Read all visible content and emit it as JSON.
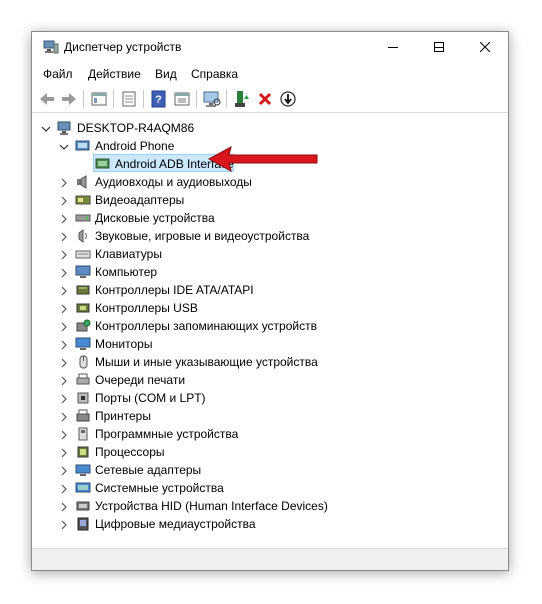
{
  "window": {
    "title": "Диспетчер устройств",
    "buttons": [
      "minimize",
      "maximize",
      "close"
    ]
  },
  "menu": {
    "file": "Файл",
    "action": "Действие",
    "view": "Вид",
    "help": "Справка"
  },
  "toolbar": {
    "icons": [
      "back-icon",
      "forward-icon",
      "properties-icon",
      "update-view-icon",
      "help-icon",
      "show-hidden-icon",
      "scan-hardware-icon",
      "update-driver-icon",
      "uninstall-icon",
      "disable-icon"
    ]
  },
  "tree": {
    "root": "DESKTOP-R4AQM86",
    "expanded_category": "Android Phone",
    "selected_device": "Android ADB Interface",
    "categories": [
      "Аудиовходы и аудиовыходы",
      "Видеоадаптеры",
      "Дисковые устройства",
      "Звуковые, игровые и видеоустройства",
      "Клавиатуры",
      "Компьютер",
      "Контроллеры IDE ATA/ATAPI",
      "Контроллеры USB",
      "Контроллеры запоминающих устройств",
      "Мониторы",
      "Мыши и иные указывающие устройства",
      "Очереди печати",
      "Порты (COM и LPT)",
      "Принтеры",
      "Программные устройства",
      "Процессоры",
      "Сетевые адаптеры",
      "Системные устройства",
      "Устройства HID (Human Interface Devices)",
      "Цифровые медиаустройства"
    ]
  },
  "colors": {
    "selection": "#cce8ff",
    "arrow": "#d9161c"
  }
}
